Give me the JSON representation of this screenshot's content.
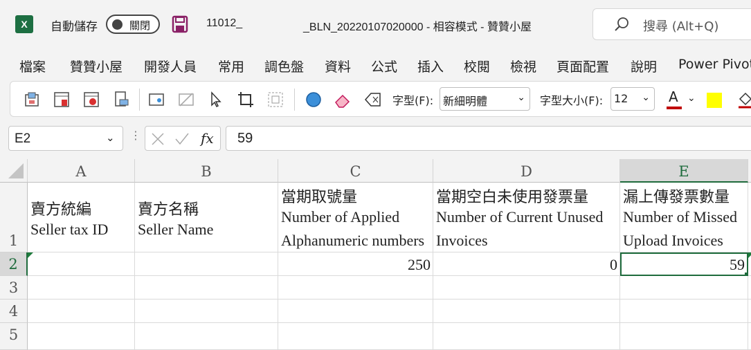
{
  "titlebar": {
    "app_icon_letter": "X",
    "autosave_label": "自動儲存",
    "autosave_state": "關閉",
    "doc_title_part1": "11012_",
    "doc_title_part2": "_BLN_20220107020000  -  相容模式  -  贊贊小屋",
    "search_placeholder": "搜尋 (Alt+Q)"
  },
  "menu": [
    "檔案",
    "贊贊小屋",
    "開發人員",
    "常用",
    "調色盤",
    "資料",
    "公式",
    "插入",
    "校閱",
    "檢視",
    "頁面配置",
    "說明",
    "Power Pivot"
  ],
  "ribbon": {
    "font_label": "字型(F):",
    "font_value": "新細明體",
    "size_label": "字型大小(F):",
    "size_value": "12",
    "font_color_letter": "A",
    "font_color": "#c00000",
    "fill_color": "#ffff00"
  },
  "formula_bar": {
    "name_box": "E2",
    "fx_symbol": "fx",
    "value": "59"
  },
  "sheet": {
    "columns": [
      "A",
      "B",
      "C",
      "D",
      "E"
    ],
    "rows": [
      "1",
      "2",
      "3",
      "4",
      "5"
    ],
    "header_row": {
      "A": [
        "賣方統編",
        "Seller tax ID"
      ],
      "B": [
        "賣方名稱",
        "Seller Name"
      ],
      "C": [
        "當期取號量",
        "Number of Applied",
        "Alphanumeric numbers"
      ],
      "D": [
        "當期空白未使用發票量",
        "Number of Current Unused",
        "Invoices"
      ],
      "E": [
        "漏上傳發票數量",
        "Number of Missed",
        "Upload Invoices"
      ]
    },
    "row2": {
      "C": "250",
      "D": "0",
      "E": "59"
    },
    "selected_cell": "E2",
    "accent_color": "#1e6b3c"
  }
}
